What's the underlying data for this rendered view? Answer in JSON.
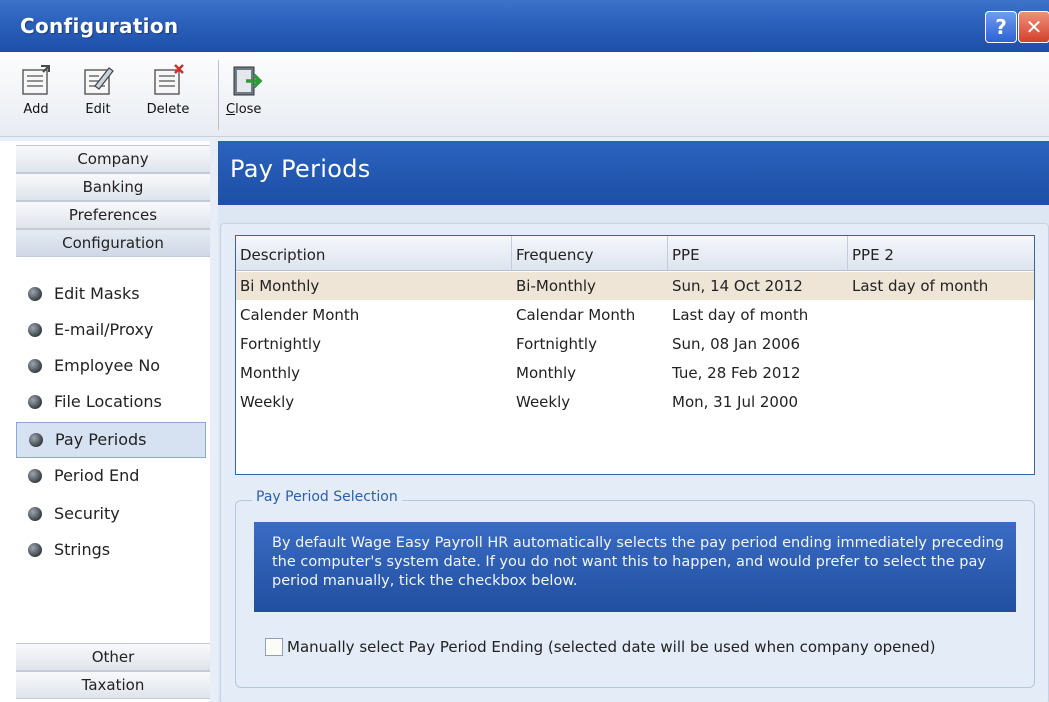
{
  "window": {
    "title": "Configuration"
  },
  "toolbar": {
    "add_label": "Add",
    "edit_label": "Edit",
    "delete_label": "Delete",
    "close_label": "Close"
  },
  "leftnav": {
    "headers_top": [
      "Company",
      "Banking",
      "Preferences",
      "Configuration"
    ],
    "items": [
      "Edit Masks",
      "E-mail/Proxy",
      "Employee No",
      "File Locations",
      "Pay Periods",
      "Period End",
      "Security",
      "Strings"
    ],
    "selected_item": "Pay Periods",
    "headers_bottom": [
      "Other",
      "Taxation"
    ]
  },
  "main": {
    "title": "Pay Periods",
    "table": {
      "columns": [
        "Description",
        "Frequency",
        "PPE",
        "PPE 2"
      ],
      "rows": [
        [
          "Bi Monthly",
          "Bi-Monthly",
          "Sun, 14 Oct 2012",
          "Last day of month"
        ],
        [
          "Calender Month",
          "Calendar Month",
          "Last day of month",
          ""
        ],
        [
          "Fortnightly",
          "Fortnightly",
          "Sun, 08 Jan 2006",
          ""
        ],
        [
          "Monthly",
          "Monthly",
          "Tue, 28 Feb 2012",
          ""
        ],
        [
          "Weekly",
          "Weekly",
          "Mon, 31 Jul 2000",
          ""
        ]
      ],
      "selected_row": 0
    },
    "selection_group": {
      "title": "Pay Period Selection",
      "info_text": "By default Wage Easy Payroll HR automatically selects the pay period ending immediately preceding the computer's system date. If you do not want this to happen, and would prefer to select the pay period manually, tick the checkbox below.",
      "checkbox_label": "Manually select Pay Period Ending (selected date will be used when company opened)",
      "checkbox_checked": false
    }
  },
  "colors": {
    "title_bar": "#2c62bd",
    "header_blue": "#1d4fa5",
    "selected_row": "#eee5d7"
  }
}
